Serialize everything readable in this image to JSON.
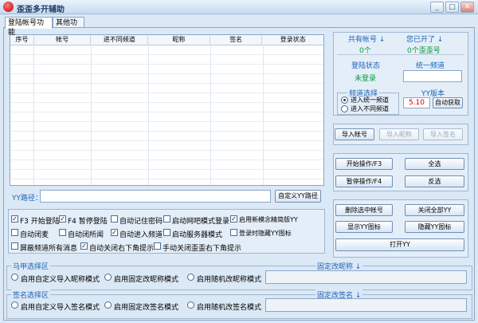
{
  "window": {
    "title": "歪歪多开辅助",
    "minimize": "_",
    "restore": "□",
    "close": "✕"
  },
  "tabs": [
    "登陆帐号功能",
    "其他功能"
  ],
  "table": {
    "columns": [
      "序号",
      "帐号",
      "进不同频道",
      "昵称",
      "签名",
      "登录状态"
    ]
  },
  "stats": {
    "total_label": "共有帐号 ↓",
    "total_value": "0个",
    "opened_label": "您已开了 ↓",
    "opened_value": "0个歪歪号",
    "login_status_label": "登陆状态",
    "login_status_value": "未登录",
    "unified_channel_label": "统一频道",
    "unified_channel_value": ""
  },
  "channel_select": {
    "legend": "频道选择",
    "options": [
      "进入统一频道",
      "进入不同频道"
    ],
    "selected": 0
  },
  "yy_version": {
    "label": "YY版本",
    "value": "5.10",
    "auto_button": "自动获取"
  },
  "import_buttons": [
    "导入帐号",
    "导入昵称",
    "导入签名"
  ],
  "actions": {
    "start": "开始操作/F3",
    "select_all": "全选",
    "pause": "暂停操作/F4",
    "invert": "反选"
  },
  "yy_path": {
    "label": "YY路径：",
    "value": "",
    "custom_button": "自定义YY路径"
  },
  "options": [
    {
      "label": "F3 开始登陆",
      "checked": true
    },
    {
      "label": "F4 暂停登陆",
      "checked": true
    },
    {
      "label": "自动记住密码",
      "checked": false
    },
    {
      "label": "启动网吧模式登录",
      "checked": false
    },
    {
      "label": "启用新模念精简版YY",
      "checked": true
    },
    {
      "label": "自动闭麦",
      "checked": false
    },
    {
      "label": "自动闭所闻",
      "checked": false
    },
    {
      "label": "自动进入频道",
      "checked": true
    },
    {
      "label": "启动服务器模式",
      "checked": false
    },
    {
      "label": "登录时隐藏YY图标",
      "checked": false
    },
    {
      "label": "屏蔽频道所有消息",
      "checked": false
    },
    {
      "label": "自动关闭右下角提示",
      "checked": true
    },
    {
      "label": "手动关闭歪歪右下角提示",
      "checked": false
    }
  ],
  "right_buttons": {
    "delete_selected": "删除选中帐号",
    "close_all": "关闭全部YY",
    "show_icon": "显示YY图标",
    "hide_icon": "隐藏YY图标",
    "open_yy": "打开YY"
  },
  "vest_section": {
    "legend": "马甲选择区",
    "options": [
      "启用自定义导入昵称模式",
      "启用固定改昵称模式",
      "启用随机改昵称模式"
    ],
    "fixed_label": "固定改昵称 ↓",
    "fixed_value": ""
  },
  "sign_section": {
    "legend": "签名选择区",
    "options": [
      "启用自定义导入签名模式",
      "启用固定改签名模式",
      "启用随机改签名模式"
    ],
    "fixed_label": "固定改签名 ↓",
    "fixed_value": ""
  }
}
